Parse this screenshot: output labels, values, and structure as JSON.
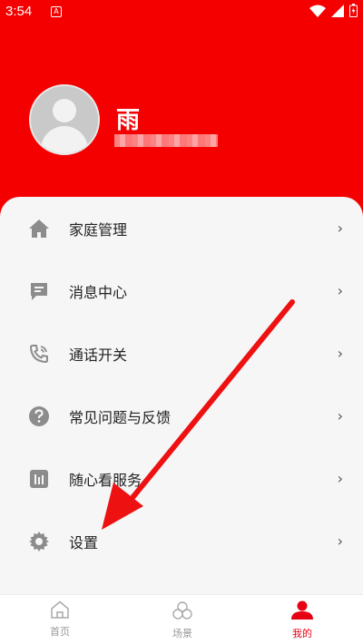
{
  "status_bar": {
    "time": "3:54",
    "notification_glyph": "A"
  },
  "profile": {
    "name": "雨"
  },
  "menu": {
    "items": [
      {
        "label": "家庭管理",
        "icon": "home-icon"
      },
      {
        "label": "消息中心",
        "icon": "message-icon"
      },
      {
        "label": "通话开关",
        "icon": "phone-icon"
      },
      {
        "label": "常见问题与反馈",
        "icon": "help-icon"
      },
      {
        "label": "随心看服务",
        "icon": "chart-icon"
      },
      {
        "label": "设置",
        "icon": "gear-icon"
      }
    ],
    "chevron": "›"
  },
  "tab_bar": {
    "tabs": [
      {
        "label": "首页",
        "icon": "home-outline-icon"
      },
      {
        "label": "场景",
        "icon": "scene-icon"
      },
      {
        "label": "我的",
        "icon": "profile-icon",
        "active": true
      }
    ]
  },
  "colors": {
    "brand_red": "#f40000",
    "active_tab": "#e60012",
    "annotation_arrow": "#ee1111"
  }
}
